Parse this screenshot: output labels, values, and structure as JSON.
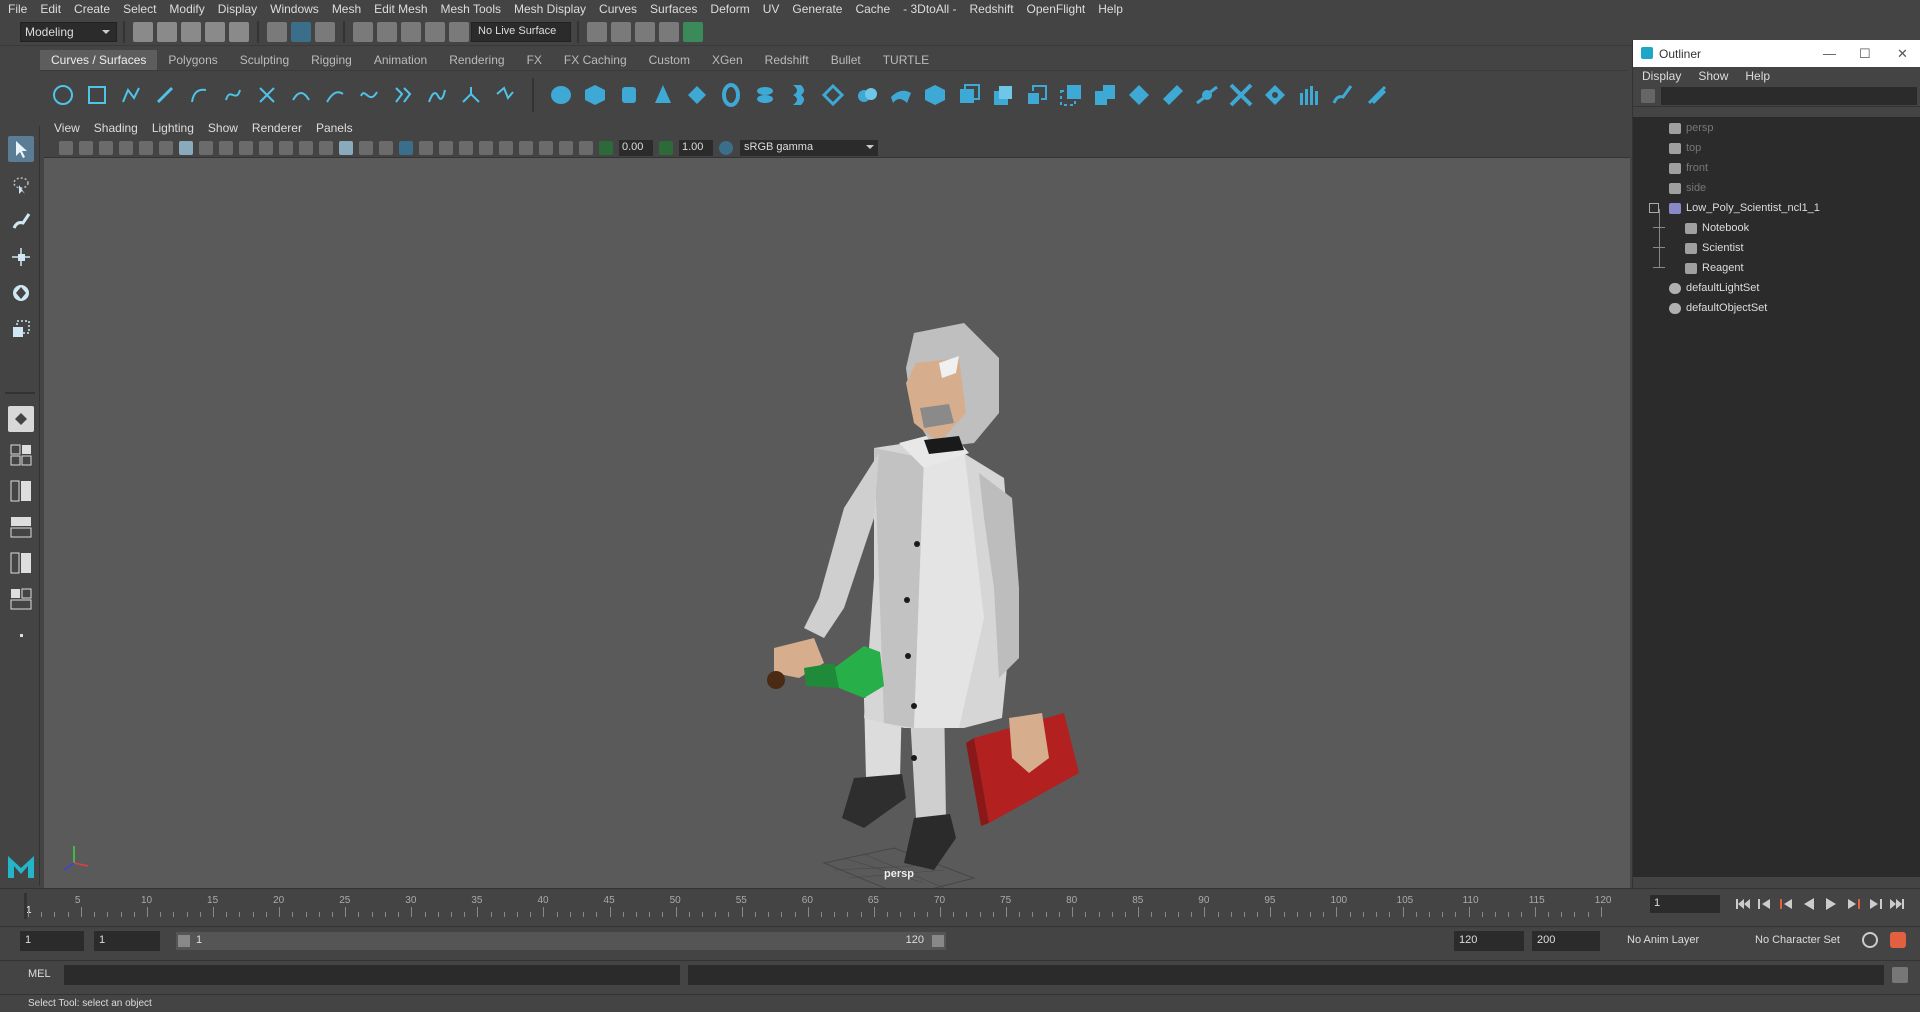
{
  "menubar": {
    "items": [
      "File",
      "Edit",
      "Create",
      "Select",
      "Modify",
      "Display",
      "Windows",
      "Mesh",
      "Edit Mesh",
      "Mesh Tools",
      "Mesh Display",
      "Curves",
      "Surfaces",
      "Deform",
      "UV",
      "Generate",
      "Cache",
      "- 3DtoAll -",
      "Redshift",
      "OpenFlight",
      "Help"
    ]
  },
  "statusline": {
    "mode": "Modeling",
    "live_surface": "No Live Surface"
  },
  "shelf": {
    "tabs": [
      "Curves / Surfaces",
      "Polygons",
      "Sculpting",
      "Rigging",
      "Animation",
      "Rendering",
      "FX",
      "FX Caching",
      "Custom",
      "XGen",
      "Redshift",
      "Bullet",
      "TURTLE"
    ],
    "active_tab": "Curves / Surfaces"
  },
  "viewport": {
    "menu": [
      "View",
      "Shading",
      "Lighting",
      "Show",
      "Renderer",
      "Panels"
    ],
    "exposure": "0.00",
    "gamma": "1.00",
    "color_space": "sRGB gamma",
    "camera_label": "persp"
  },
  "outliner": {
    "title": "Outliner",
    "menu": [
      "Display",
      "Show",
      "Help"
    ],
    "items": [
      {
        "label": "persp",
        "type": "camera",
        "dim": true
      },
      {
        "label": "top",
        "type": "camera",
        "dim": true
      },
      {
        "label": "front",
        "type": "camera",
        "dim": true
      },
      {
        "label": "side",
        "type": "camera",
        "dim": true
      },
      {
        "label": "Low_Poly_Scientist_ncl1_1",
        "type": "group"
      },
      {
        "label": "Notebook",
        "type": "mesh"
      },
      {
        "label": "Scientist",
        "type": "mesh"
      },
      {
        "label": "Reagent",
        "type": "mesh"
      },
      {
        "label": "defaultLightSet",
        "type": "set"
      },
      {
        "label": "defaultObjectSet",
        "type": "set"
      }
    ]
  },
  "timeline": {
    "ticks": [
      "5",
      "10",
      "15",
      "20",
      "25",
      "30",
      "35",
      "40",
      "45",
      "50",
      "55",
      "60",
      "65",
      "70",
      "75",
      "80",
      "85",
      "90",
      "95",
      "100",
      "105",
      "110",
      "115",
      "120"
    ],
    "start_label": "1",
    "current_frame": "1"
  },
  "range": {
    "start": "1",
    "start2": "1",
    "slider_start": "1",
    "slider_end": "120",
    "end": "120",
    "end2": "200",
    "anim_layer": "No Anim Layer",
    "char_set": "No Character Set"
  },
  "cmdline": {
    "lang": "MEL"
  },
  "help": {
    "text": "Select Tool: select an object"
  },
  "colors": {
    "accent": "#3fb6d9",
    "bg": "#444444",
    "viewport": "#5a5a5a",
    "dark": "#2b2b2b"
  }
}
